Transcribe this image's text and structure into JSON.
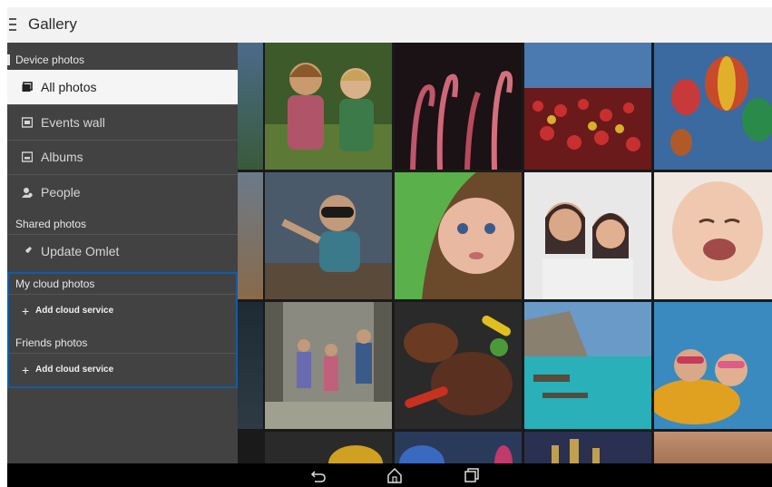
{
  "app": {
    "title": "Gallery"
  },
  "drawer": {
    "sections": {
      "device": "Device photos",
      "shared": "Shared photos",
      "cloud": "My cloud photos",
      "friends": "Friends photos"
    },
    "items": {
      "all_photos": "All photos",
      "events_wall": "Events wall",
      "albums": "Albums",
      "people": "People",
      "update_omlet": "Update Omlet",
      "add_cloud_1": "Add cloud service",
      "add_cloud_2": "Add cloud service"
    },
    "selected": "All photos",
    "highlight_color": "#0e5ea8"
  },
  "navbar": {
    "buttons": [
      "back-icon",
      "home-icon",
      "recent-apps-icon"
    ]
  }
}
